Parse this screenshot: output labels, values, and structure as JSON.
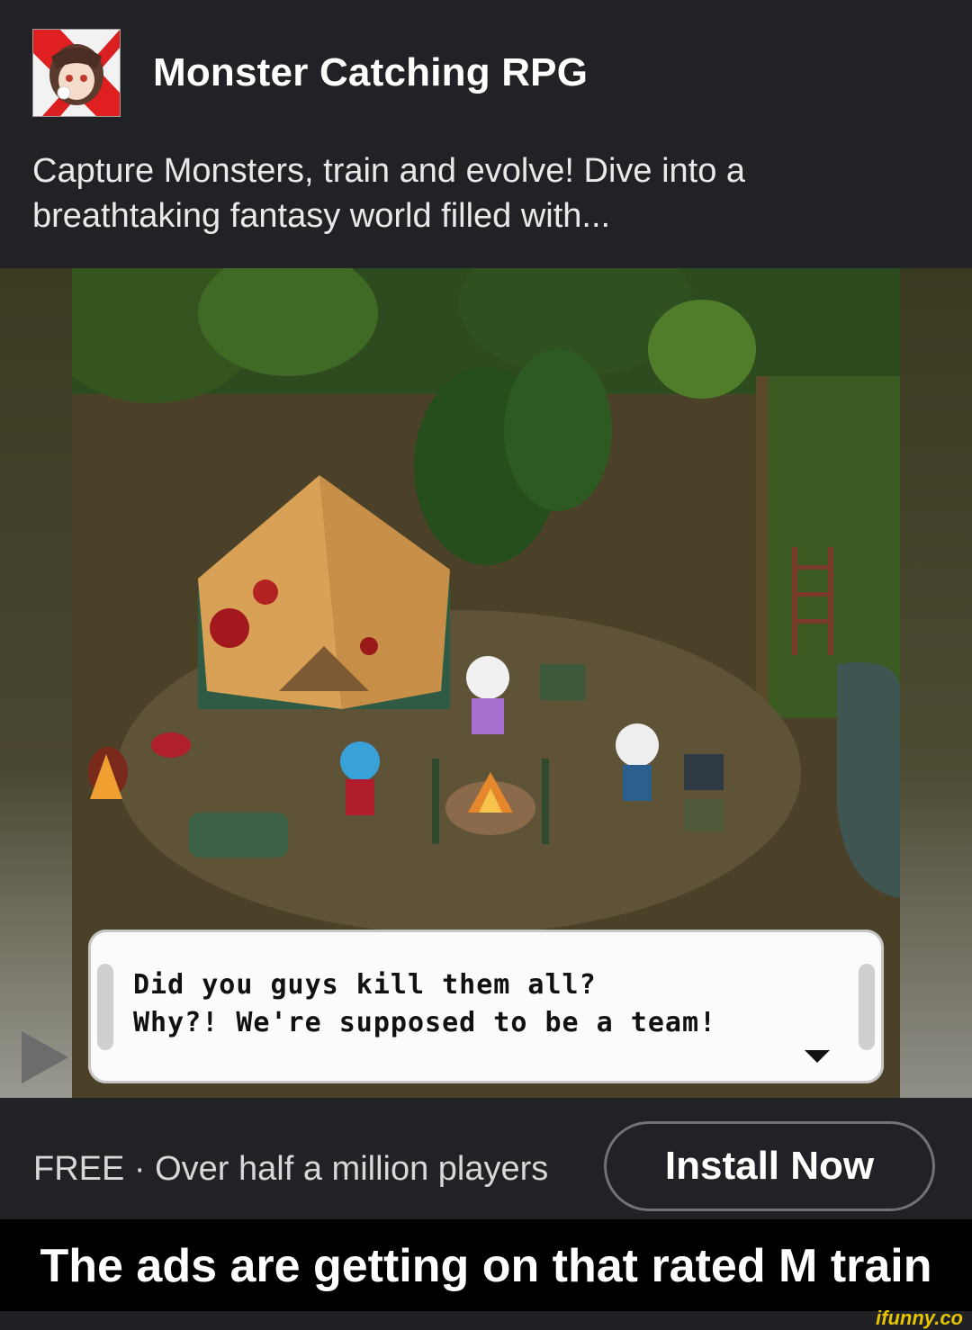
{
  "ad": {
    "app_title": "Monster Catching RPG",
    "description": "Capture Monsters, train and evolve!  Dive into a breathtaking fantasy world filled with...",
    "icon": "anime-girl-app-icon",
    "dialog": {
      "line1": "Did you guys kill them all?",
      "line2": "Why?! We're supposed to be a team!"
    },
    "footer_text": "FREE · Over half a million players",
    "install_label": "Install Now",
    "play_icon": "play-triangle-icon"
  },
  "meme": {
    "caption": "The ads are getting on that rated M train",
    "watermark": "ifunny.co"
  },
  "colors": {
    "card_bg": "#202226",
    "caption_bg": "#000000",
    "watermark": "#e7c400"
  }
}
